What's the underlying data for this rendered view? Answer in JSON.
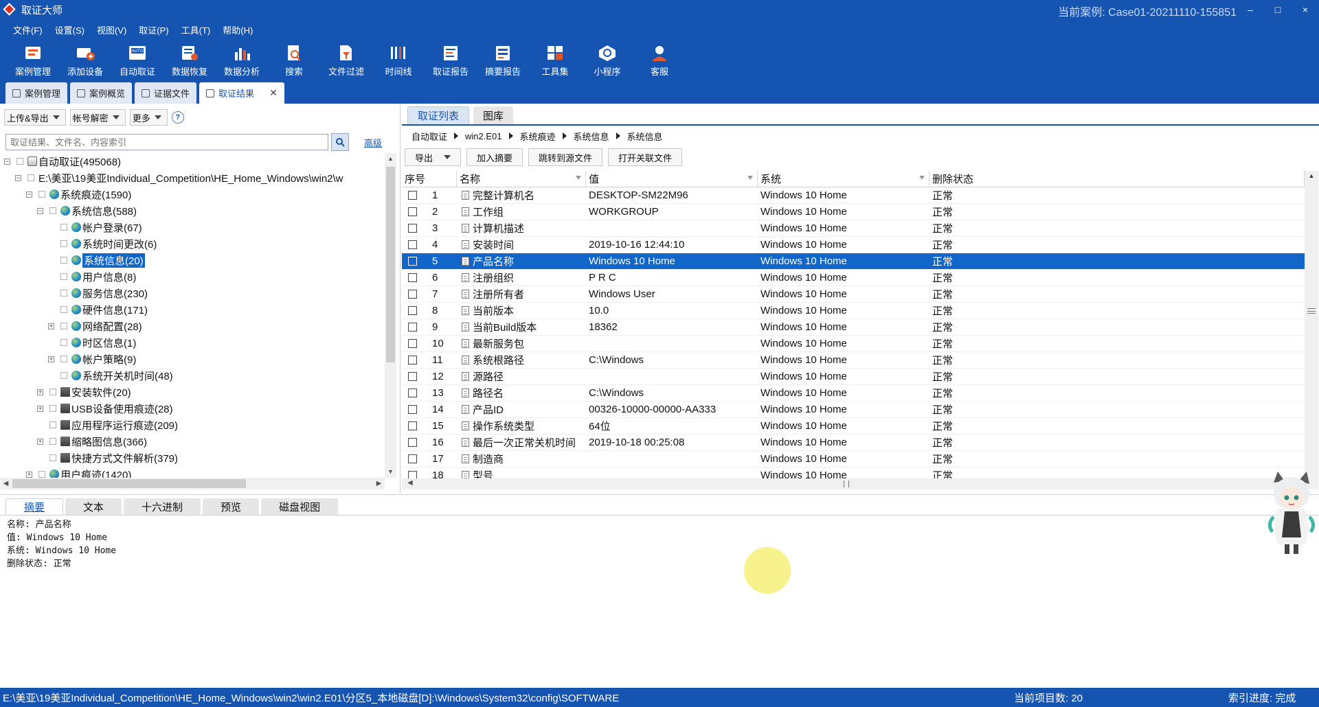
{
  "window": {
    "title": "取证大师",
    "case_label": "当前案例:  Case01-20211110-155851",
    "controls": [
      "–",
      "□",
      "×"
    ]
  },
  "menu": [
    "文件(F)",
    "设置(S)",
    "视图(V)",
    "取证(P)",
    "工具(T)",
    "帮助(H)"
  ],
  "toolbar": [
    {
      "label": "案例管理",
      "icon": "case-manage-icon"
    },
    {
      "label": "添加设备",
      "icon": "add-device-icon"
    },
    {
      "label": "自动取证",
      "icon": "auto-forensics-icon"
    },
    {
      "label": "数据恢复",
      "icon": "data-recovery-icon"
    },
    {
      "label": "数据分析",
      "icon": "data-analysis-icon"
    },
    {
      "label": "搜索",
      "icon": "search-doc-icon"
    },
    {
      "label": "文件过滤",
      "icon": "file-filter-icon"
    },
    {
      "label": "时间线",
      "icon": "timeline-icon"
    },
    {
      "label": "取证报告",
      "icon": "report-icon"
    },
    {
      "label": "摘要报告",
      "icon": "summary-report-icon"
    },
    {
      "label": "工具集",
      "icon": "toolset-icon"
    },
    {
      "label": "小程序",
      "icon": "mini-program-icon"
    },
    {
      "label": "客服",
      "icon": "support-icon"
    }
  ],
  "doc_tabs": [
    "案例管理",
    "案例概览",
    "证据文件",
    "取证结果"
  ],
  "left": {
    "actions": [
      "上传&导出",
      "帐号解密",
      "更多"
    ],
    "help": "?",
    "search_placeholder": "取证结果、文件名、内容索引",
    "advanced": "高级",
    "tree": [
      {
        "label": "自动取证(495068)",
        "level": 0,
        "exp": "-",
        "icon": "disk"
      },
      {
        "label": "E:\\美亚\\19美亚Individual_Competition\\HE_Home_Windows\\win2\\w",
        "level": 1,
        "exp": "-",
        "icon": "none"
      },
      {
        "label": "系统痕迹(1590)",
        "level": 2,
        "exp": "-",
        "icon": "globe"
      },
      {
        "label": "系统信息(588)",
        "level": 3,
        "exp": "-",
        "icon": "globe"
      },
      {
        "label": "帐户登录(67)",
        "level": 4,
        "exp": "",
        "icon": "globe"
      },
      {
        "label": "系统时间更改(6)",
        "level": 4,
        "exp": "",
        "icon": "globe"
      },
      {
        "label": "系统信息(20)",
        "level": 4,
        "exp": "",
        "icon": "globe",
        "selected": true
      },
      {
        "label": "用户信息(8)",
        "level": 4,
        "exp": "",
        "icon": "globe"
      },
      {
        "label": "服务信息(230)",
        "level": 4,
        "exp": "",
        "icon": "globe"
      },
      {
        "label": "硬件信息(171)",
        "level": 4,
        "exp": "",
        "icon": "globe"
      },
      {
        "label": "网络配置(28)",
        "level": 4,
        "exp": "+",
        "icon": "globe"
      },
      {
        "label": "时区信息(1)",
        "level": 4,
        "exp": "",
        "icon": "globe"
      },
      {
        "label": "帐户策略(9)",
        "level": 4,
        "exp": "+",
        "icon": "globe"
      },
      {
        "label": "系统开关机时间(48)",
        "level": 4,
        "exp": "",
        "icon": "globe"
      },
      {
        "label": "安装软件(20)",
        "level": 3,
        "exp": "+",
        "icon": "folder"
      },
      {
        "label": "USB设备使用痕迹(28)",
        "level": 3,
        "exp": "+",
        "icon": "folder"
      },
      {
        "label": "应用程序运行痕迹(209)",
        "level": 3,
        "exp": "",
        "icon": "folder"
      },
      {
        "label": "缩略图信息(366)",
        "level": 3,
        "exp": "+",
        "icon": "folder"
      },
      {
        "label": "快捷方式文件解析(379)",
        "level": 3,
        "exp": "",
        "icon": "folder"
      },
      {
        "label": "用户痕迹(1420)",
        "level": 2,
        "exp": "+",
        "icon": "globe"
      }
    ]
  },
  "right": {
    "tabs": [
      "取证列表",
      "图库"
    ],
    "breadcrumb": [
      "自动取证",
      "win2.E01",
      "系统痕迹",
      "系统信息",
      "系统信息"
    ],
    "actions": [
      "导出",
      "加入摘要",
      "跳转到源文件",
      "打开关联文件"
    ],
    "columns": [
      "序号",
      "名称",
      "值",
      "系统",
      "删除状态"
    ],
    "rows": [
      {
        "no": "1",
        "name": "完整计算机名",
        "value": "DESKTOP-SM22M96",
        "system": "Windows 10 Home",
        "status": "正常"
      },
      {
        "no": "2",
        "name": "工作组",
        "value": "WORKGROUP",
        "system": "Windows 10 Home",
        "status": "正常"
      },
      {
        "no": "3",
        "name": "计算机描述",
        "value": "",
        "system": "Windows 10 Home",
        "status": "正常"
      },
      {
        "no": "4",
        "name": "安装时间",
        "value": "2019-10-16 12:44:10",
        "system": "Windows 10 Home",
        "status": "正常"
      },
      {
        "no": "5",
        "name": "产品名称",
        "value": "Windows 10 Home",
        "system": "Windows 10 Home",
        "status": "正常",
        "selected": true
      },
      {
        "no": "6",
        "name": "注册组织",
        "value": "P R C",
        "system": "Windows 10 Home",
        "status": "正常"
      },
      {
        "no": "7",
        "name": "注册所有者",
        "value": "Windows User",
        "system": "Windows 10 Home",
        "status": "正常"
      },
      {
        "no": "8",
        "name": "当前版本",
        "value": "10.0",
        "system": "Windows 10 Home",
        "status": "正常"
      },
      {
        "no": "9",
        "name": "当前Build版本",
        "value": "18362",
        "system": "Windows 10 Home",
        "status": "正常"
      },
      {
        "no": "10",
        "name": "最新服务包",
        "value": "",
        "system": "Windows 10 Home",
        "status": "正常"
      },
      {
        "no": "11",
        "name": "系统根路径",
        "value": "C:\\Windows",
        "system": "Windows 10 Home",
        "status": "正常"
      },
      {
        "no": "12",
        "name": "源路径",
        "value": "",
        "system": "Windows 10 Home",
        "status": "正常"
      },
      {
        "no": "13",
        "name": "路径名",
        "value": "C:\\Windows",
        "system": "Windows 10 Home",
        "status": "正常"
      },
      {
        "no": "14",
        "name": "产品ID",
        "value": "00326-10000-00000-AA333",
        "system": "Windows 10 Home",
        "status": "正常"
      },
      {
        "no": "15",
        "name": "操作系统类型",
        "value": "64位",
        "system": "Windows 10 Home",
        "status": "正常"
      },
      {
        "no": "16",
        "name": "最后一次正常关机时间",
        "value": "2019-10-18 00:25:08",
        "system": "Windows 10 Home",
        "status": "正常"
      },
      {
        "no": "17",
        "name": "制造商",
        "value": "",
        "system": "Windows 10 Home",
        "status": "正常"
      },
      {
        "no": "18",
        "name": "型号",
        "value": "",
        "system": "Windows 10 Home",
        "status": "正常"
      }
    ]
  },
  "bottom": {
    "tabs": [
      "摘要",
      "文本",
      "十六进制",
      "预览",
      "磁盘视图"
    ],
    "summary_lines": [
      "名称: 产品名称",
      "值: Windows 10 Home",
      "系统: Windows 10 Home",
      "删除状态: 正常"
    ]
  },
  "status": {
    "path": "E:\\美亚\\19美亚Individual_Competition\\HE_Home_Windows\\win2\\win2.E01\\分区5_本地磁盘[D]:\\Windows\\System32\\config\\SOFTWARE",
    "count": "当前项目数: 20",
    "progress": "索引进度: 完成"
  },
  "colors": {
    "primary": "#1554b0",
    "selection": "#1166c9"
  }
}
